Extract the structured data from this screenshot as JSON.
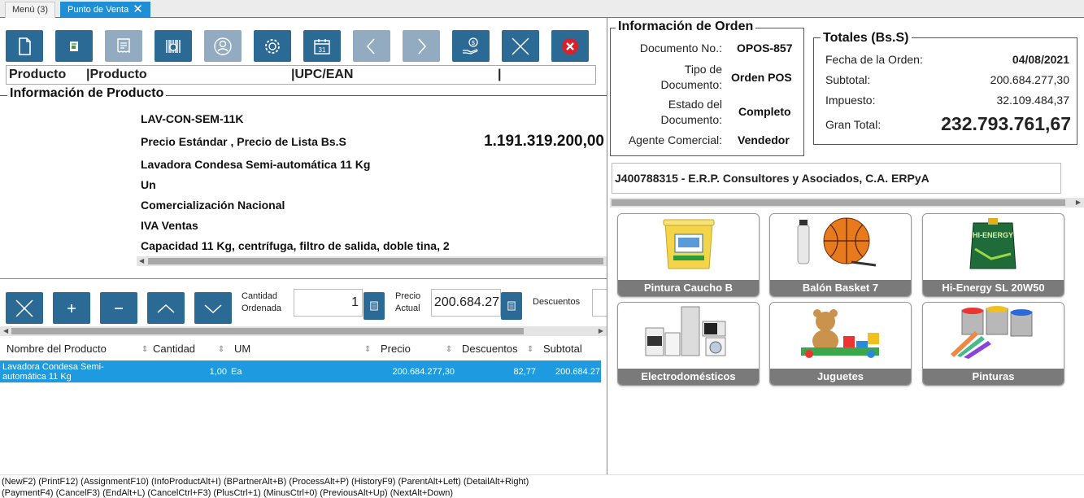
{
  "tabs": [
    {
      "label": "Menú (3)"
    },
    {
      "label": "Punto de Venta"
    }
  ],
  "toolbar": {
    "icons": [
      "new-document-icon",
      "image-icon",
      "receipt-icon",
      "barcode-icon",
      "customer-icon",
      "settings-icon",
      "calendar-icon",
      "previous-icon",
      "next-icon",
      "payment-icon",
      "cancel-icon",
      "close-icon"
    ],
    "calendar_day": "31"
  },
  "product_search": {
    "columns": [
      "Producto",
      "|Producto",
      "|UPC/EAN",
      "|"
    ]
  },
  "product_info": {
    "title": "Información de Producto",
    "code": "LAV-CON-SEM-11K",
    "price_list": "Precio Estándar , Precio de Lista Bs.S",
    "price": "1.191.319.200,00",
    "name": "Lavadora Condesa Semi-automática 11 Kg",
    "uom": "Un",
    "category": "Comercialización Nacional",
    "tax": "IVA Ventas",
    "description": "Capacidad 11 Kg, centrífuga, filtro de salida, doble tina, 2"
  },
  "line_controls": {
    "qty_label_1": "Cantidad",
    "qty_label_2": "Ordenada",
    "qty_value": "1",
    "price_label_1": "Precio",
    "price_label_2": "Actual",
    "price_value": "200.684.27",
    "discount_label": "Descuentos"
  },
  "lines_table": {
    "headers": [
      "Nombre del Producto",
      "Cantidad",
      "UM",
      "Precio",
      "Descuentos",
      "Subtotal"
    ],
    "rows": [
      {
        "name_1": "Lavadora Condesa Semi-",
        "name_2": "automática 11 Kg",
        "qty": "1,00",
        "uom": "Ea",
        "price": "200.684.277,30",
        "discount": "82,77",
        "subtotal": "200.684.27"
      }
    ]
  },
  "order_info": {
    "title": "Información de Orden",
    "doc_no_label": "Documento No.:",
    "doc_no": "OPOS-857",
    "doc_type_label_1": "Tipo de",
    "doc_type_label_2": "Documento:",
    "doc_type": "Orden POS",
    "doc_status_label_1": "Estado del",
    "doc_status_label_2": "Documento:",
    "doc_status": "Completo",
    "agent_label": "Agente Comercial:",
    "agent": "Vendedor"
  },
  "totals": {
    "title": "Totales (Bs.S)",
    "date_label": "Fecha de la Orden:",
    "date": "04/08/2021",
    "subtotal_label": "Subtotal:",
    "subtotal": "200.684.277,30",
    "tax_label": "Impuesto:",
    "tax": "32.109.484,37",
    "grand_label": "Gran Total:",
    "grand": "232.793.761,67"
  },
  "customer": "J400788315 - E.R.P. Consultores y Asociados, C.A. ERPyA",
  "quick_products": [
    {
      "label": "Pintura Caucho B"
    },
    {
      "label": "Balón Basket 7"
    },
    {
      "label": "Hi-Energy SL 20W50"
    },
    {
      "label": "Electrodomésticos"
    },
    {
      "label": "Juguetes"
    },
    {
      "label": "Pinturas"
    }
  ],
  "footer": {
    "line1": "(NewF2) (PrintF12) (AssignmentF10) (InfoProductAlt+I) (BPartnerAlt+B) (ProcessAlt+P) (HistoryF9) (ParentAlt+Left) (DetailAlt+Right)",
    "line2": "(PaymentF4) (CancelF3) (EndAlt+L) (CancelCtrl+F3) (PlusCtrl+1) (MinusCtrl+0) (PreviousAlt+Up) (NextAlt+Down)"
  },
  "colors": {
    "accent": "#1e8fd6",
    "button": "#2c6a96",
    "button_disabled": "#93abc0",
    "danger": "#c0151a",
    "selected_row": "#1e9be0"
  }
}
